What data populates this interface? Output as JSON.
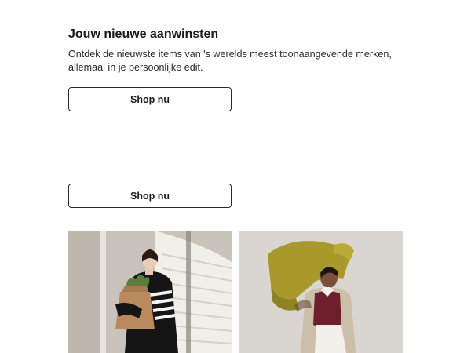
{
  "section": {
    "title": "Jouw nieuwe aanwinsten",
    "description": "Ontdek de nieuwste items van 's werelds meest toonaangevende merken,\nallemaal in je persoonlijke edit."
  },
  "buttons": {
    "primary_label": "Shop nu",
    "secondary_label": "Shop nu"
  },
  "images": [
    {
      "icon": "product-photo-woman-grocery-bag"
    },
    {
      "icon": "product-photo-man-carrying-chair"
    }
  ]
}
